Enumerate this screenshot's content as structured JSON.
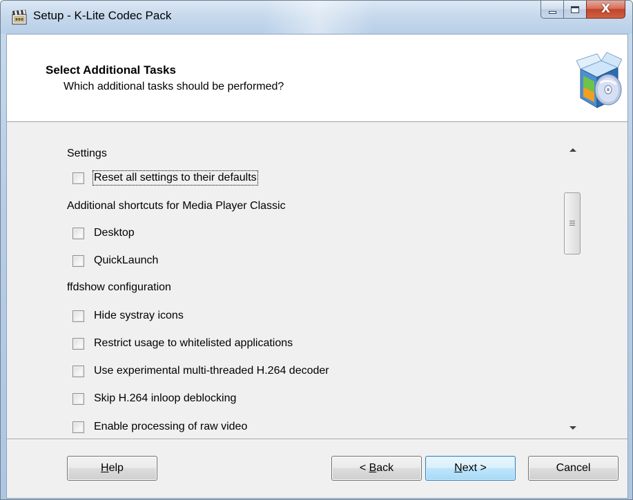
{
  "window": {
    "title": "Setup - K-Lite Codec Pack",
    "controls": {
      "minimize_icon": "minimize-icon",
      "maximize_icon": "maximize-icon",
      "close_icon": "close-icon",
      "close_glyph": "X"
    }
  },
  "header": {
    "title": "Select Additional Tasks",
    "subtitle": "Which additional tasks should be performed?",
    "icon": "installer-box-cd-icon"
  },
  "tasks": {
    "groups": [
      {
        "label": "Settings",
        "items": [
          {
            "label": "Reset all settings to their defaults",
            "checked": false,
            "focused": true
          }
        ]
      },
      {
        "label": "Additional shortcuts for Media Player Classic",
        "items": [
          {
            "label": "Desktop",
            "checked": false
          },
          {
            "label": "QuickLaunch",
            "checked": false
          }
        ]
      },
      {
        "label": "ffdshow configuration",
        "items": [
          {
            "label": "Hide systray icons",
            "checked": false
          },
          {
            "label": "Restrict usage to whitelisted applications",
            "checked": false
          },
          {
            "label": "Use experimental multi-threaded H.264 decoder",
            "checked": false
          },
          {
            "label": "Skip H.264 inloop deblocking",
            "checked": false
          },
          {
            "label": "Enable processing of raw video",
            "checked": false
          }
        ]
      }
    ]
  },
  "buttons": {
    "help": {
      "mnemonic": "H",
      "rest": "elp"
    },
    "back": {
      "prefix": "< ",
      "mnemonic": "B",
      "rest": "ack"
    },
    "next": {
      "mnemonic": "N",
      "rest": "ext >"
    },
    "cancel": {
      "label": "Cancel"
    }
  },
  "colors": {
    "title_bar": "#c5d8ec",
    "client_background": "#f0f0f0",
    "header_background": "#ffffff",
    "close_button": "#c0452c",
    "default_button_border": "#3c7fb1"
  }
}
